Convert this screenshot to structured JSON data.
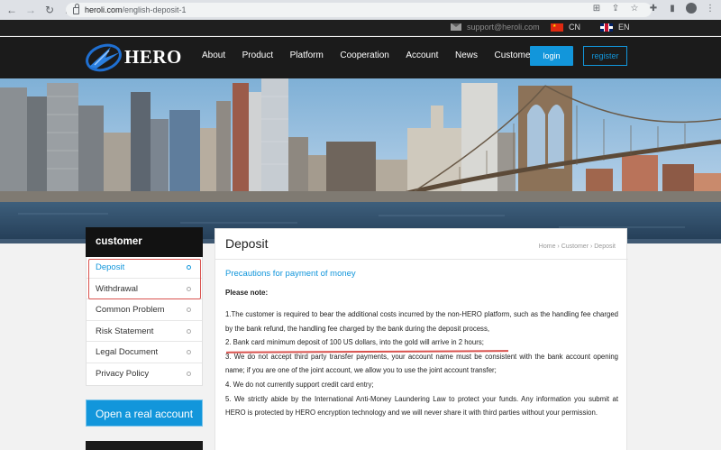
{
  "browser": {
    "url_host": "heroli.com",
    "url_path": "/english-deposit-1",
    "avatar_letter": "●"
  },
  "topbar": {
    "email": "support@heroli.com",
    "lang_cn": "CN",
    "lang_en": "EN"
  },
  "header": {
    "logo_text": "HERO",
    "menu": [
      "About",
      "Product",
      "Platform",
      "Cooperation",
      "Account",
      "News",
      "Customer"
    ],
    "login": "login",
    "register": "register"
  },
  "sidebar": {
    "title": "customer",
    "items": [
      {
        "label": "Deposit",
        "active": true
      },
      {
        "label": "Withdrawal",
        "active": false
      },
      {
        "label": "Common Problem",
        "active": false
      },
      {
        "label": "Risk Statement",
        "active": false
      },
      {
        "label": "Legal Document",
        "active": false
      },
      {
        "label": "Privacy Policy",
        "active": false
      }
    ],
    "open_account": "Open a real account"
  },
  "main": {
    "title": "Deposit",
    "breadcrumb": "Home › Customer › Deposit",
    "subheading": "Precautions for payment of money",
    "note_label": "Please note:",
    "paragraphs": [
      "1.The customer is required to bear the additional costs incurred by the non-HERO platform, such as the handling fee charged by the bank refund, the handling fee charged by the bank during the deposit process,",
      "2. Bank card minimum deposit of 100 US dollars, into the gold will arrive in 2 hours;",
      "3. We do not accept third party transfer payments, your account name must be consistent with the bank account opening name; if you are one of the joint account, we allow you to use the joint account transfer;",
      "4. We do not currently support credit card entry;",
      "5. We strictly abide by the International Anti-Money Laundering Law to protect your funds. Any information you submit at HERO is protected by HERO encryption technology and we will never share it with third parties without your permission."
    ]
  },
  "colors": {
    "accent": "#1296db",
    "header_bg": "#1b1b1b",
    "highlight": "#d9534f"
  }
}
